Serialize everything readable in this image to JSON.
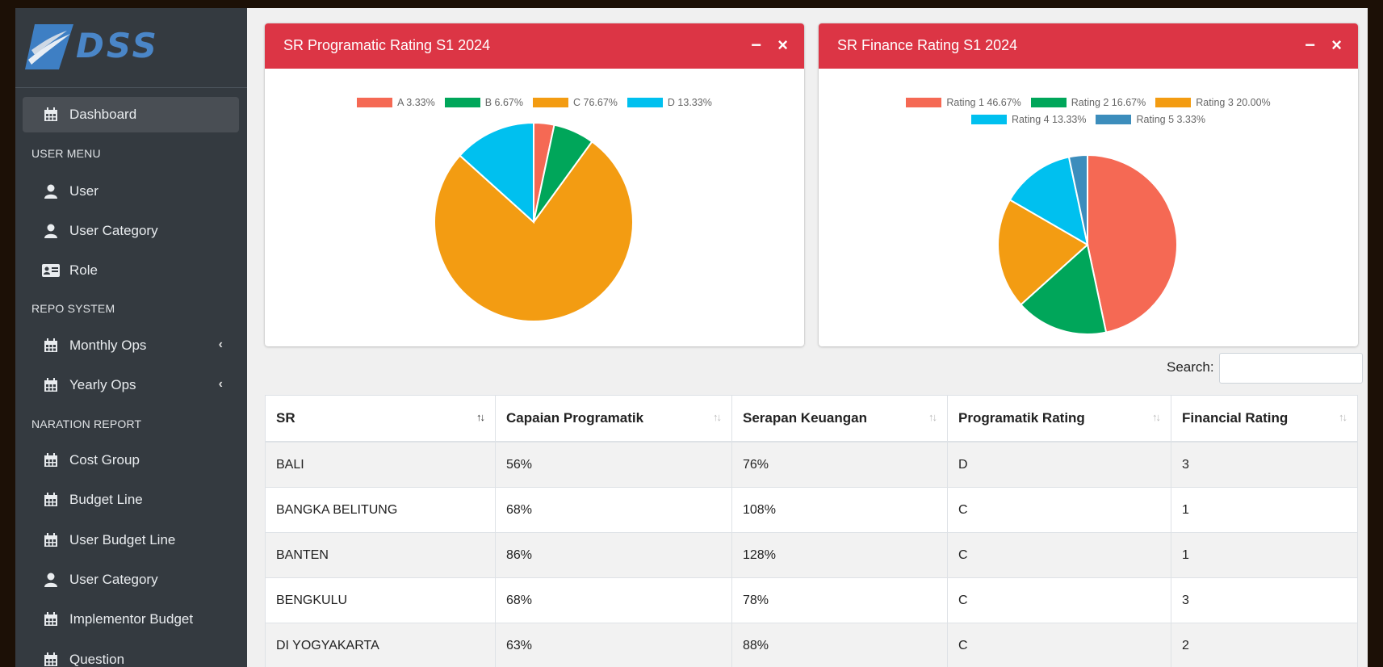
{
  "sidebar": {
    "logo_text": "DSS",
    "items": [
      {
        "label": "Dashboard",
        "icon": "calendar-icon"
      },
      {
        "label": "User",
        "icon": "user-icon"
      },
      {
        "label": "User Category",
        "icon": "user-icon"
      },
      {
        "label": "Role",
        "icon": "id-card-icon"
      },
      {
        "label": "Monthly Ops",
        "icon": "calendar-icon"
      },
      {
        "label": "Yearly Ops",
        "icon": "calendar-icon"
      },
      {
        "label": "Cost Group",
        "icon": "calendar-icon"
      },
      {
        "label": "Budget Line",
        "icon": "calendar-icon"
      },
      {
        "label": "User Budget Line",
        "icon": "calendar-icon"
      },
      {
        "label": "User Category",
        "icon": "user-icon"
      },
      {
        "label": "Implementor Budget",
        "icon": "calendar-icon"
      },
      {
        "label": "Question",
        "icon": "calendar-icon"
      }
    ],
    "headers": [
      "USER MENU",
      "REPO SYSTEM",
      "NARATION REPORT"
    ]
  },
  "cards": [
    {
      "title": "SR Programatic Rating S1 2024",
      "minimize": "−",
      "close": "×"
    },
    {
      "title": "SR Finance Rating S1 2024",
      "minimize": "−",
      "close": "×"
    }
  ],
  "chart_data": [
    {
      "type": "pie",
      "title": "SR Programatic Rating S1 2024",
      "labels": [
        "A 3.33%",
        "B 6.67%",
        "C 76.67%",
        "D 13.33%"
      ],
      "values": [
        3.33,
        6.67,
        76.67,
        13.33
      ],
      "colors": [
        "#f56954",
        "#00a65a",
        "#f39c12",
        "#00c0ef"
      ],
      "legend": "top"
    },
    {
      "type": "pie",
      "title": "SR Finance Rating S1 2024",
      "labels": [
        "Rating 1 46.67%",
        "Rating 2 16.67%",
        "Rating 3 20.00%",
        "Rating 4 13.33%",
        "Rating 5 3.33%"
      ],
      "values": [
        46.67,
        16.67,
        20.0,
        13.33,
        3.33
      ],
      "colors": [
        "#f56954",
        "#00a65a",
        "#f39c12",
        "#00c0ef",
        "#3c8dbc"
      ],
      "legend": "top"
    }
  ],
  "search": {
    "label": "Search:",
    "value": ""
  },
  "table": {
    "columns": [
      "SR",
      "Capaian Programatik",
      "Serapan Keuangan",
      "Programatik Rating",
      "Financial Rating"
    ],
    "rows": [
      [
        "BALI",
        "56%",
        "76%",
        "D",
        "3"
      ],
      [
        "BANGKA BELITUNG",
        "68%",
        "108%",
        "C",
        "1"
      ],
      [
        "BANTEN",
        "86%",
        "128%",
        "C",
        "1"
      ],
      [
        "BENGKULU",
        "68%",
        "78%",
        "C",
        "3"
      ],
      [
        "DI YOGYAKARTA",
        "63%",
        "88%",
        "C",
        "2"
      ]
    ]
  }
}
